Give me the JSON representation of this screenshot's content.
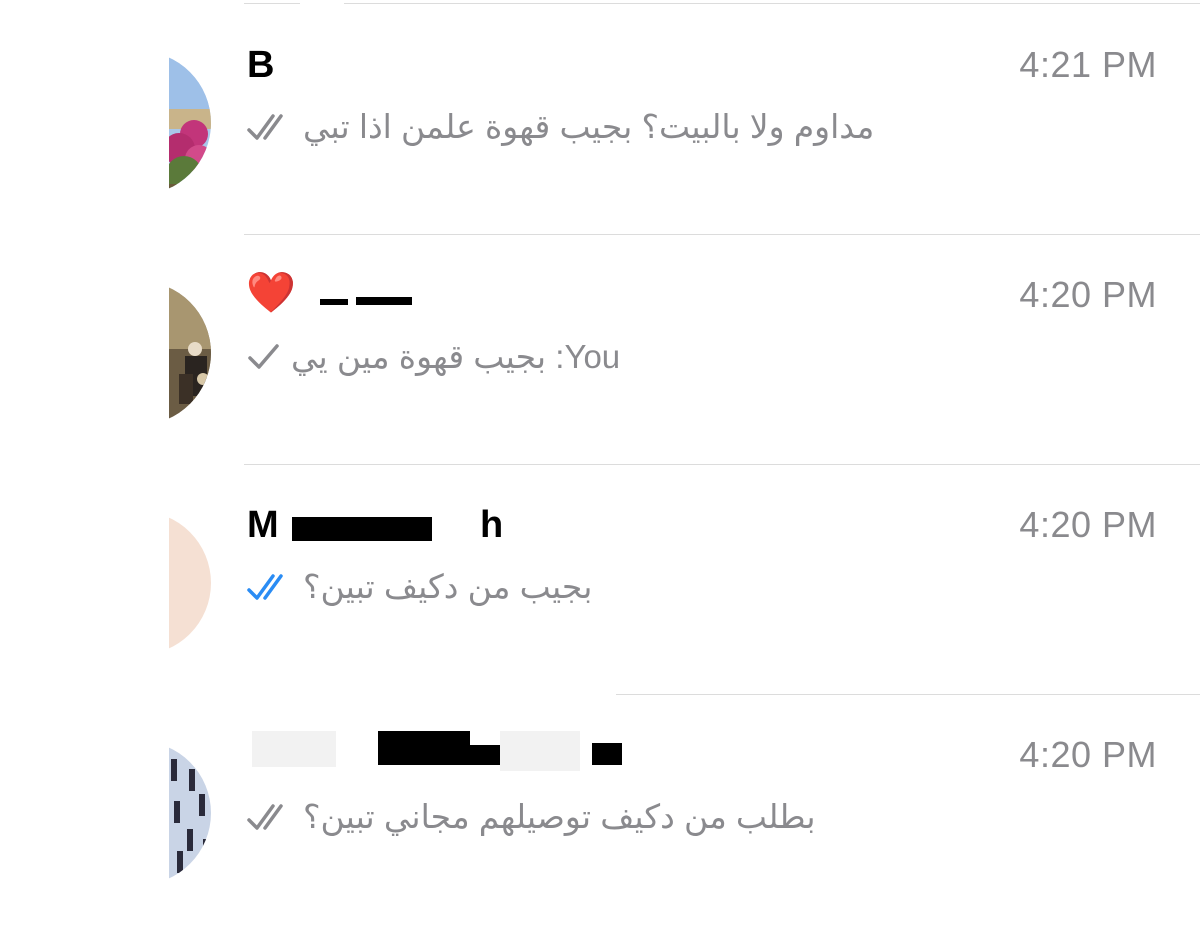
{
  "chats": [
    {
      "name": "B",
      "time": "4:21 PM",
      "message": "مداوم ولا بالبيت؟ بجيب قهوة علمن اذا تبي",
      "status": "read-gray",
      "avatar": "flowers-photo"
    },
    {
      "name": "",
      "name_emoji": "❤️",
      "time": "4:20 PM",
      "message": "You: بجيب قهوة مين يي",
      "status": "sent-single",
      "avatar": "people-photo"
    },
    {
      "name": "M",
      "name_tail": "h",
      "time": "4:20 PM",
      "message": "بجيب من دكيف تبين؟",
      "status": "read-blue",
      "avatar": "peach-solid"
    },
    {
      "name": "",
      "time": "4:20 PM",
      "message": "بطلب من دكيف توصيلهم مجاني تبين؟",
      "status": "read-gray",
      "avatar": "figures-pattern"
    }
  ],
  "colors": {
    "time": "#8a8a8e",
    "preview": "#8a8a8e",
    "check_gray": "#8a8a8e",
    "check_blue": "#2a8cf4",
    "divider": "#dcdcdc"
  }
}
